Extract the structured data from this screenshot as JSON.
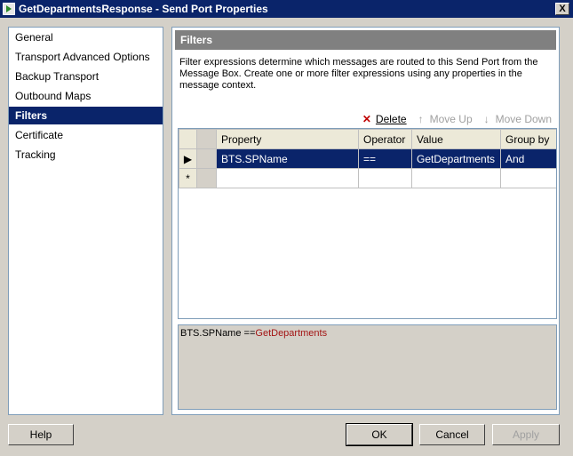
{
  "window": {
    "title": "GetDepartmentsResponse - Send Port Properties",
    "close_label": "X"
  },
  "sidebar": {
    "items": [
      {
        "label": "General",
        "selected": false
      },
      {
        "label": "Transport Advanced Options",
        "selected": false
      },
      {
        "label": "Backup Transport",
        "selected": false
      },
      {
        "label": "Outbound Maps",
        "selected": false
      },
      {
        "label": "Filters",
        "selected": true
      },
      {
        "label": "Certificate",
        "selected": false
      },
      {
        "label": "Tracking",
        "selected": false
      }
    ]
  },
  "panel": {
    "title": "Filters",
    "description": "Filter expressions determine which messages are routed to this Send Port from the Message Box. Create one or more filter expressions using any properties in the message context."
  },
  "toolbar": {
    "delete_label": "Delete",
    "move_up_label": "Move Up",
    "move_down_label": "Move Down"
  },
  "grid": {
    "columns": [
      "Property",
      "Operator",
      "Value",
      "Group by"
    ],
    "rows": [
      {
        "property": "BTS.SPName",
        "operator": "==",
        "value": "GetDepartments",
        "group_by": "And"
      }
    ],
    "new_row_marker": "*",
    "current_row_marker": "▶"
  },
  "expression": {
    "property": "BTS.SPName",
    "operator": "==",
    "value": "GetDepartments"
  },
  "buttons": {
    "help": "Help",
    "ok": "OK",
    "cancel": "Cancel",
    "apply": "Apply"
  },
  "colors": {
    "title_bar": "#0a246a",
    "selection": "#0a246a",
    "header_band": "#808080",
    "expression_value": "#a31515"
  }
}
